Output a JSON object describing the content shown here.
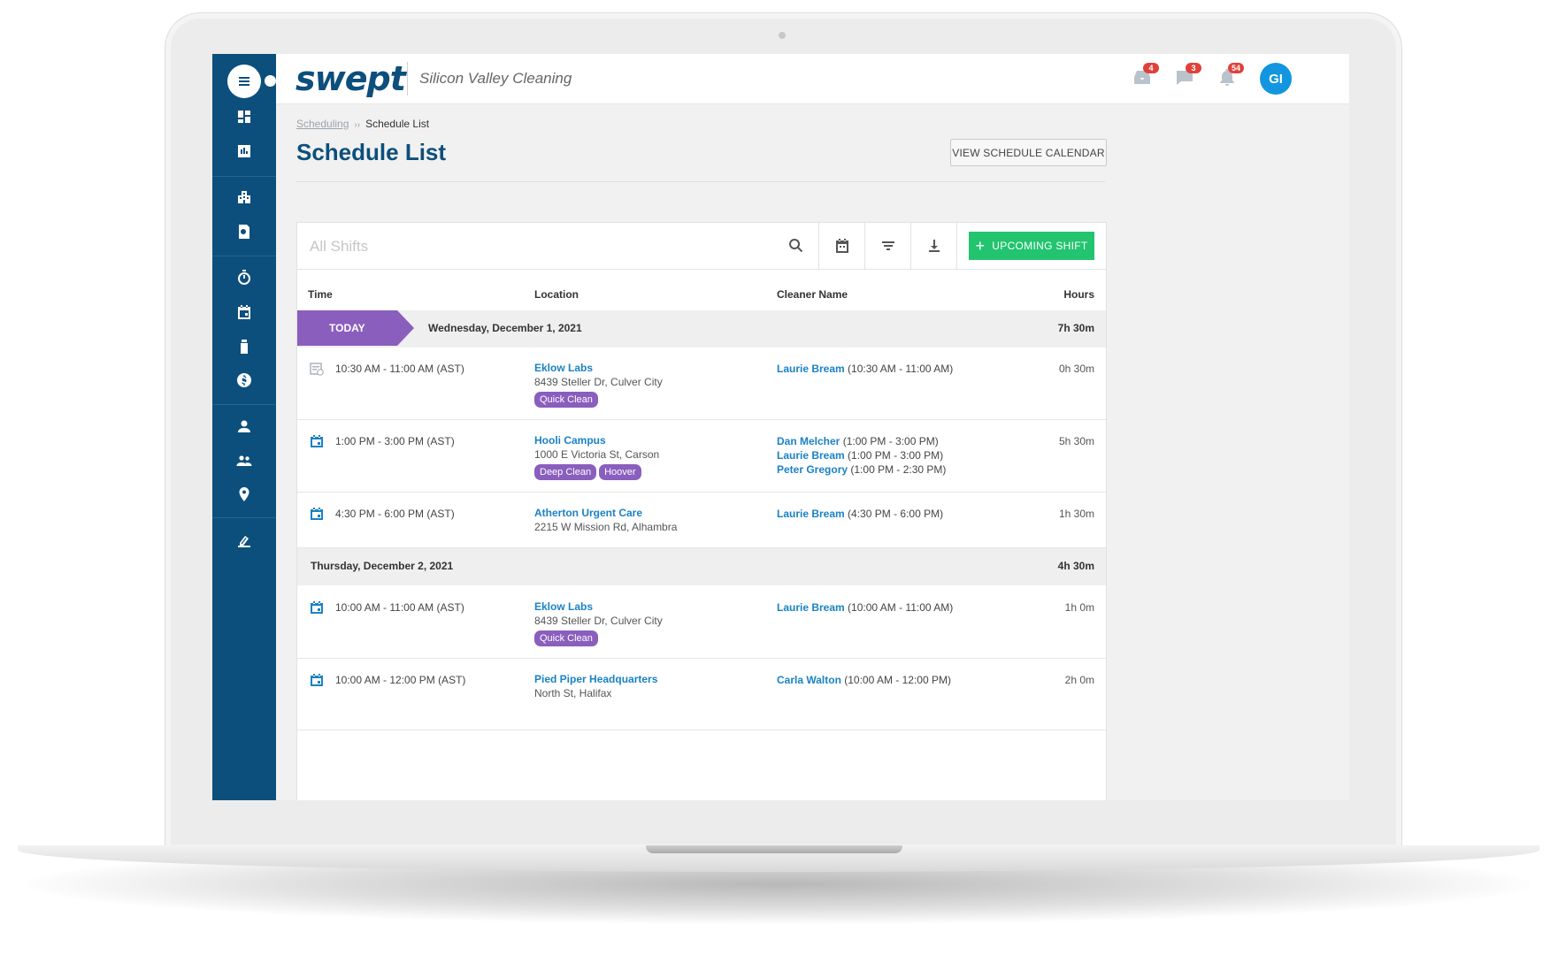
{
  "app": {
    "logo": "swept",
    "company": "Silicon Valley Cleaning",
    "avatar_initials": "GI"
  },
  "header": {
    "notifications": [
      {
        "icon": "inbox-icon",
        "count": "4"
      },
      {
        "icon": "chat-icon",
        "count": "3"
      },
      {
        "icon": "bell-icon",
        "count": "54"
      }
    ]
  },
  "sidebar": {
    "items": [
      {
        "icon": "dashboard-icon"
      },
      {
        "icon": "reports-icon"
      },
      {
        "icon": "buildings-icon"
      },
      {
        "icon": "inspection-icon"
      },
      {
        "icon": "timer-icon"
      },
      {
        "icon": "calendar-icon"
      },
      {
        "icon": "supplies-icon"
      },
      {
        "icon": "billing-icon"
      },
      {
        "icon": "employee-icon"
      },
      {
        "icon": "team-icon"
      },
      {
        "icon": "location-icon"
      },
      {
        "icon": "settings-icon"
      }
    ]
  },
  "breadcrumb": {
    "parent": "Scheduling",
    "separator": "››",
    "current": "Schedule List"
  },
  "page": {
    "title": "Schedule List",
    "view_calendar_button": "VIEW SCHEDULE CALENDAR"
  },
  "toolbar": {
    "search_placeholder": "All Shifts",
    "upcoming_button": "UPCOMING SHIFT",
    "upcoming_plus": "+"
  },
  "table": {
    "headers": {
      "time": "Time",
      "location": "Location",
      "cleaner": "Cleaner Name",
      "hours": "Hours"
    },
    "days": [
      {
        "today_label": "TODAY",
        "date": "Wednesday, December 1, 2021",
        "total_hours": "7h 30m",
        "shifts": [
          {
            "time": "10:30 AM - 11:00 AM (AST)",
            "location": "Eklow Labs",
            "address": "8439 Steller Dr, Culver City",
            "tags": [
              "Quick Clean"
            ],
            "cleaners": [
              {
                "name": "Laurie Bream",
                "time": "(10:30 AM - 11:00 AM)"
              }
            ],
            "hours": "0h 30m",
            "icon": "shift-complete-icon"
          },
          {
            "time": "1:00 PM - 3:00 PM (AST)",
            "location": "Hooli Campus",
            "address": "1000 E Victoria St, Carson",
            "tags": [
              "Deep Clean",
              "Hoover"
            ],
            "cleaners": [
              {
                "name": "Dan Melcher",
                "time": "(1:00 PM - 3:00 PM)"
              },
              {
                "name": "Laurie Bream",
                "time": "(1:00 PM - 3:00 PM)"
              },
              {
                "name": "Peter Gregory",
                "time": "(1:00 PM - 2:30 PM)"
              }
            ],
            "hours": "5h 30m",
            "icon": "calendar-icon"
          },
          {
            "time": "4:30 PM - 6:00 PM (AST)",
            "location": "Atherton Urgent Care",
            "address": "2215 W Mission Rd, Alhambra",
            "tags": [],
            "cleaners": [
              {
                "name": "Laurie Bream",
                "time": "(4:30 PM - 6:00 PM)"
              }
            ],
            "hours": "1h 30m",
            "icon": "calendar-icon"
          }
        ]
      },
      {
        "today_label": "",
        "date": "Thursday, December 2, 2021",
        "total_hours": "4h 30m",
        "shifts": [
          {
            "time": "10:00 AM - 11:00 AM (AST)",
            "location": "Eklow Labs",
            "address": "8439 Steller Dr, Culver City",
            "tags": [
              "Quick Clean"
            ],
            "cleaners": [
              {
                "name": "Laurie Bream",
                "time": "(10:00 AM - 11:00 AM)"
              }
            ],
            "hours": "1h 0m",
            "icon": "calendar-icon"
          },
          {
            "time": "10:00 AM - 12:00 PM (AST)",
            "location": "Pied Piper Headquarters",
            "address": "North St, Halifax",
            "tags": [],
            "cleaners": [
              {
                "name": "Carla Walton",
                "time": "(10:00 AM - 12:00 PM)"
              }
            ],
            "hours": "2h 0m",
            "icon": "calendar-icon"
          }
        ]
      }
    ]
  },
  "colors": {
    "brand": "#0c4f7c",
    "link": "#1a82c4",
    "accent_green": "#22c46f",
    "tag_purple": "#8a5ebd",
    "badge_red": "#e0413a"
  }
}
